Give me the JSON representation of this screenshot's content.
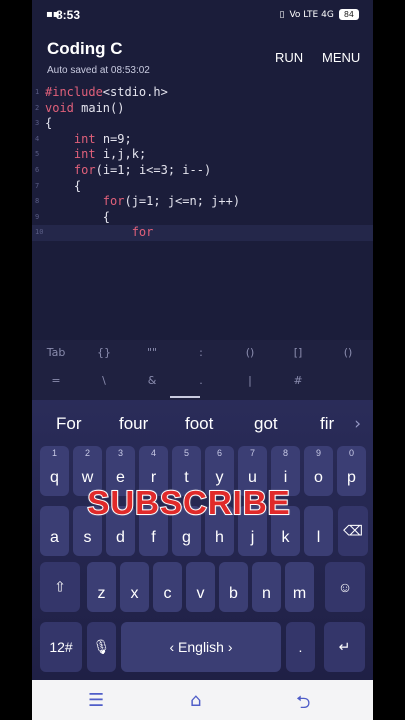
{
  "status": {
    "time": "8:53",
    "network": "Vo LTE 4G",
    "battery": "84"
  },
  "header": {
    "title": "Coding C",
    "subtitle": "Auto saved at 08:53:02",
    "run_label": "RUN",
    "menu_label": "MENU"
  },
  "editor": {
    "lines": [
      {
        "num": "1",
        "text": "#include<stdio.h>"
      },
      {
        "num": "2",
        "text": "void main()"
      },
      {
        "num": "3",
        "text": "{"
      },
      {
        "num": "4",
        "text": "    int n=9;"
      },
      {
        "num": "5",
        "text": "    int i,j,k;"
      },
      {
        "num": "6",
        "text": "    for(i=1; i<=3; i--)"
      },
      {
        "num": "7",
        "text": "    {"
      },
      {
        "num": "8",
        "text": "        for(j=1; j<=n; j++)"
      },
      {
        "num": "9",
        "text": "        {"
      },
      {
        "num": "10",
        "text": "            for"
      }
    ]
  },
  "symbols": {
    "row1": [
      "Tab",
      "{}",
      "\"\"",
      ":",
      "()",
      "[]",
      "()"
    ],
    "row2": [
      "=",
      "\\",
      "&",
      ".",
      "|",
      "#",
      ""
    ]
  },
  "suggestions": [
    "For",
    "four",
    "foot",
    "got",
    "fir"
  ],
  "keyboard": {
    "row1": [
      {
        "k": "q",
        "h": "1"
      },
      {
        "k": "w",
        "h": "2"
      },
      {
        "k": "e",
        "h": "3"
      },
      {
        "k": "r",
        "h": "4"
      },
      {
        "k": "t",
        "h": "5"
      },
      {
        "k": "y",
        "h": "6"
      },
      {
        "k": "u",
        "h": "7"
      },
      {
        "k": "i",
        "h": "8"
      },
      {
        "k": "o",
        "h": "9"
      },
      {
        "k": "p",
        "h": "0"
      }
    ],
    "row2": [
      {
        "k": "a",
        "h": ""
      },
      {
        "k": "s",
        "h": ""
      },
      {
        "k": "d",
        "h": ""
      },
      {
        "k": "f",
        "h": ""
      },
      {
        "k": "g",
        "h": ""
      },
      {
        "k": "h",
        "h": ""
      },
      {
        "k": "j",
        "h": ""
      },
      {
        "k": "k",
        "h": ""
      },
      {
        "k": "l",
        "h": ""
      }
    ],
    "row2_sub": [
      "-",
      "_",
      "(",
      ")",
      "&",
      "\"",
      "?",
      "!"
    ],
    "row3": [
      {
        "k": "z",
        "h": "",
        "s": "@"
      },
      {
        "k": "x",
        "h": "",
        "s": "#"
      },
      {
        "k": "c",
        "h": "",
        "s": ""
      },
      {
        "k": "v",
        "h": "",
        "s": ""
      },
      {
        "k": "b",
        "h": "",
        "s": ""
      },
      {
        "k": "n",
        "h": "",
        "s": ""
      },
      {
        "k": "m",
        "h": "",
        "s": ""
      }
    ],
    "numbers_label": "12#",
    "space_label": "English",
    "space_left": "‹",
    "space_right": "›",
    "comma": ",",
    "period": "."
  },
  "overlay": {
    "text": "SUBSCRIBE"
  },
  "icons": {
    "shift": "shift-icon",
    "backspace": "backspace-icon",
    "emoji": "emoji-icon",
    "enter": "enter-icon",
    "mic": "mic-icon"
  },
  "colors": {
    "editor_bg": "#1b1d3a",
    "keyword": "#e0607a",
    "key_bg": "#3b3e74",
    "overlay_red": "#e02a2a"
  }
}
